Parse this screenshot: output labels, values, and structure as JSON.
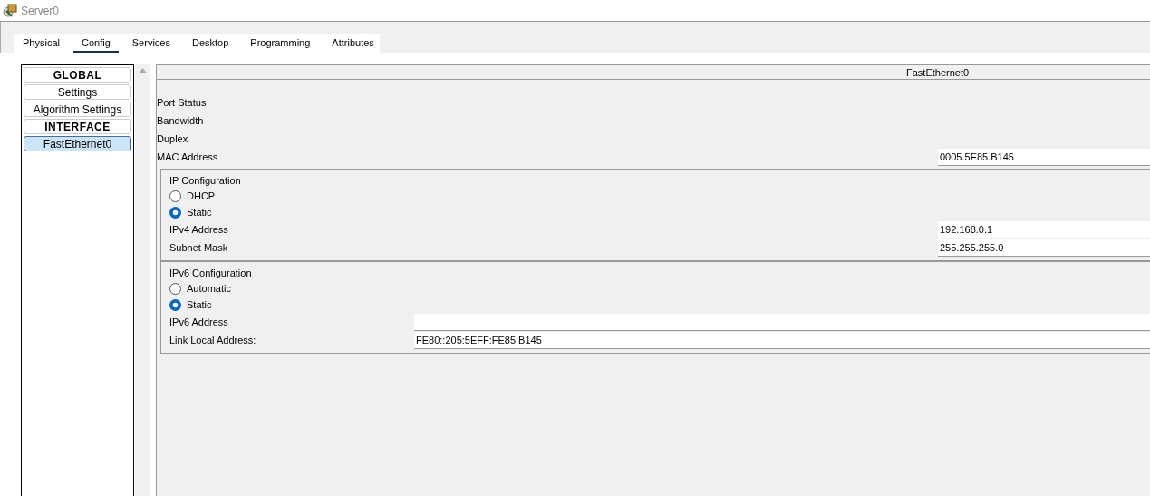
{
  "window": {
    "title": "Server0"
  },
  "tabs": [
    {
      "label": "Physical",
      "selected": false
    },
    {
      "label": "Config",
      "selected": true
    },
    {
      "label": "Services",
      "selected": false
    },
    {
      "label": "Desktop",
      "selected": false
    },
    {
      "label": "Programming",
      "selected": false
    },
    {
      "label": "Attributes",
      "selected": false
    }
  ],
  "sidebar": {
    "items": [
      {
        "label": "GLOBAL",
        "kind": "heading",
        "selected": false
      },
      {
        "label": "Settings",
        "kind": "item",
        "selected": false
      },
      {
        "label": "Algorithm Settings",
        "kind": "item",
        "selected": false
      },
      {
        "label": "INTERFACE",
        "kind": "heading",
        "selected": false
      },
      {
        "label": "FastEthernet0",
        "kind": "item",
        "selected": true
      }
    ]
  },
  "panel": {
    "title": "FastEthernet0",
    "fields": [
      {
        "label": "Port Status"
      },
      {
        "label": "Bandwidth"
      },
      {
        "label": "Duplex"
      },
      {
        "label": "MAC Address",
        "value": "0005.5E85.B145"
      }
    ],
    "ip_configuration": {
      "title": "IP Configuration",
      "options": [
        {
          "label": "DHCP",
          "selected": false
        },
        {
          "label": "Static",
          "selected": true
        }
      ],
      "fields": [
        {
          "label": "IPv4 Address",
          "value": "192.168.0.1"
        },
        {
          "label": "Subnet Mask",
          "value": "255.255.255.0"
        }
      ]
    },
    "ipv6_configuration": {
      "title": "IPv6 Configuration",
      "options": [
        {
          "label": "Automatic",
          "selected": false
        },
        {
          "label": "Static",
          "selected": true
        }
      ],
      "fields": [
        {
          "label": "IPv6 Address"
        },
        {
          "label": "Link Local Address:",
          "value": "FE80::205:5EFF:FE85:B145"
        }
      ]
    }
  }
}
